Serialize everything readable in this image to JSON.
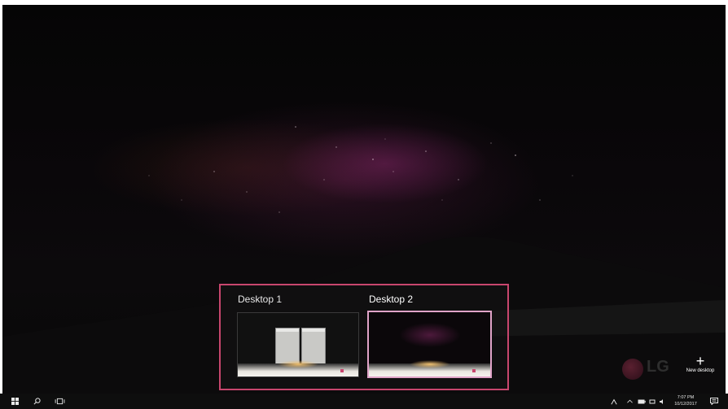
{
  "task_view": {
    "desktops": [
      {
        "label": "Desktop 1",
        "active": false
      },
      {
        "label": "Desktop 2",
        "active": true
      }
    ],
    "new_desktop_label": "New desktop",
    "new_desktop_icon": "plus-icon"
  },
  "watermark": {
    "logo_text": "LG"
  },
  "taskbar": {
    "icons": [
      "windows-start-icon",
      "search-icon",
      "task-view-icon"
    ],
    "tray_icons": [
      "people-icon",
      "chevron-up-icon",
      "battery-icon",
      "network-icon",
      "volume-icon",
      "action-center-icon"
    ],
    "time": "7:07 PM",
    "date": "10/12/2017"
  },
  "colors": {
    "highlight_border": "#c8466e",
    "active_thumb_border": "#e0a3c8",
    "taskbar_bg": "#0e0e0e"
  }
}
